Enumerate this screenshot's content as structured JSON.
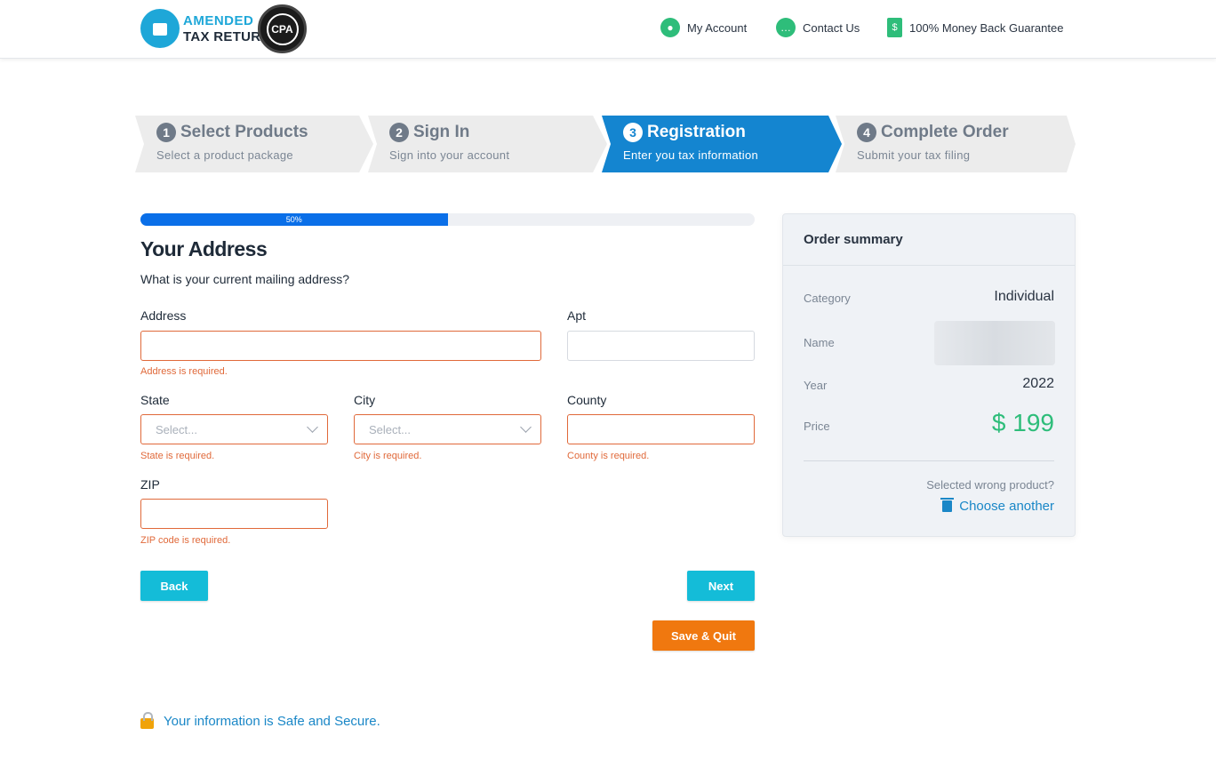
{
  "header": {
    "logo_line1": "AMENDED",
    "logo_line2": "TAX RETURN",
    "cpa_badge": "CPA",
    "nav": [
      {
        "label": "My Account",
        "icon": "user-icon"
      },
      {
        "label": "Contact Us",
        "icon": "chat-icon"
      },
      {
        "label": "100% Money Back Guarantee",
        "icon": "dollar-document-icon"
      }
    ]
  },
  "steps": [
    {
      "num": "1",
      "title": "Select Products",
      "sub": "Select a product package",
      "active": false
    },
    {
      "num": "2",
      "title": "Sign In",
      "sub": "Sign into your account",
      "active": false
    },
    {
      "num": "3",
      "title": "Registration",
      "sub": "Enter you tax information",
      "active": true
    },
    {
      "num": "4",
      "title": "Complete Order",
      "sub": "Submit your tax filing",
      "active": false
    }
  ],
  "progress": {
    "value": 0.5,
    "label": "50%"
  },
  "form": {
    "title": "Your Address",
    "question": "What is your current mailing address?",
    "address": {
      "label": "Address",
      "value": "",
      "error": "Address is required."
    },
    "apt": {
      "label": "Apt",
      "value": ""
    },
    "state": {
      "label": "State",
      "placeholder": "Select...",
      "error": "State is required."
    },
    "city": {
      "label": "City",
      "placeholder": "Select...",
      "error": "City is required."
    },
    "county": {
      "label": "County",
      "value": "",
      "error": "County is required."
    },
    "zip": {
      "label": "ZIP",
      "value": "",
      "error": "ZIP code is required."
    },
    "back_label": "Back",
    "next_label": "Next",
    "save_label": "Save & Quit"
  },
  "secure_text": "Your information is Safe and Secure.",
  "summary": {
    "title": "Order summary",
    "category_label": "Category",
    "category_value": "Individual",
    "name_label": "Name",
    "year_label": "Year",
    "year_value": "2022",
    "price_label": "Price",
    "price_value": "$ 199",
    "wrong_text": "Selected wrong product?",
    "choose_text": "Choose another"
  },
  "colors": {
    "accent_blue": "#1485d0",
    "progress_blue": "#0a6fe8",
    "error_orange": "#e0693a",
    "button_cyan": "#14bcd8",
    "button_orange": "#f0780f",
    "price_green": "#2ebd7a"
  }
}
